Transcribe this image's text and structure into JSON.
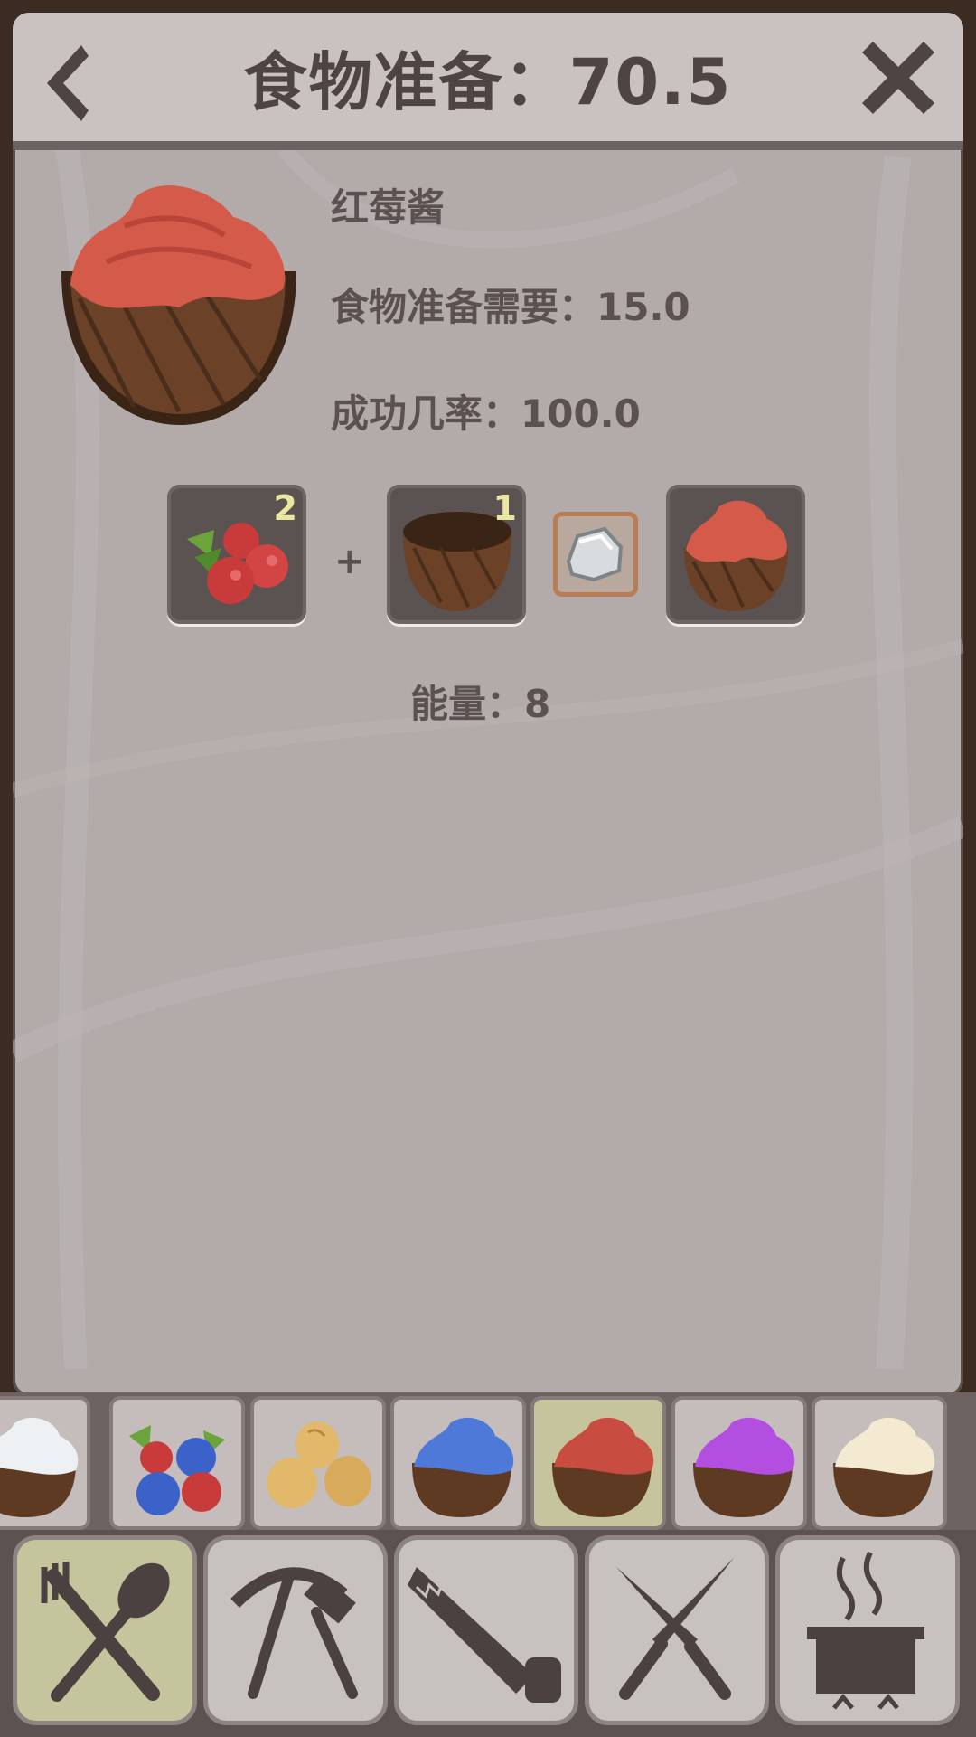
{
  "header": {
    "title": "食物准备：70.5",
    "back_icon": "chevron-left-icon",
    "close_icon": "close-x-icon"
  },
  "recipe": {
    "name": "红莓酱",
    "requirement": "食物准备需要：15.0",
    "success_rate": "成功几率：100.0",
    "energy": "能量：8",
    "ingredients": [
      {
        "icon": "red-berries-icon",
        "quantity": "2"
      },
      {
        "icon": "coconut-bowl-icon",
        "quantity": "1"
      }
    ],
    "plus_sign": "+",
    "tool_icon": "stone-icon",
    "result_icon": "red-berry-jam-icon"
  },
  "recipe_strip": {
    "items": [
      {
        "icon": "white-cream-bowl-icon",
        "selected": false
      },
      {
        "icon": "mixed-berries-icon",
        "selected": false
      },
      {
        "icon": "nuts-icon",
        "selected": false
      },
      {
        "icon": "blue-jam-icon",
        "selected": false
      },
      {
        "icon": "red-jam-icon",
        "selected": true
      },
      {
        "icon": "purple-jam-icon",
        "selected": false
      },
      {
        "icon": "cream-jam-icon",
        "selected": false
      }
    ]
  },
  "category_tabs": [
    {
      "icon": "fork-spoon-icon",
      "selected": true
    },
    {
      "icon": "pickaxe-hammer-icon",
      "selected": false
    },
    {
      "icon": "saw-icon",
      "selected": false
    },
    {
      "icon": "crossed-knives-icon",
      "selected": false
    },
    {
      "icon": "cooking-pot-icon",
      "selected": false
    }
  ],
  "colors": {
    "panel": "#b2abaa",
    "header": "#c9c2c0",
    "text": "#5a5150",
    "selected_tab": "#c4c59c",
    "jam_red": "#d45a4a"
  }
}
